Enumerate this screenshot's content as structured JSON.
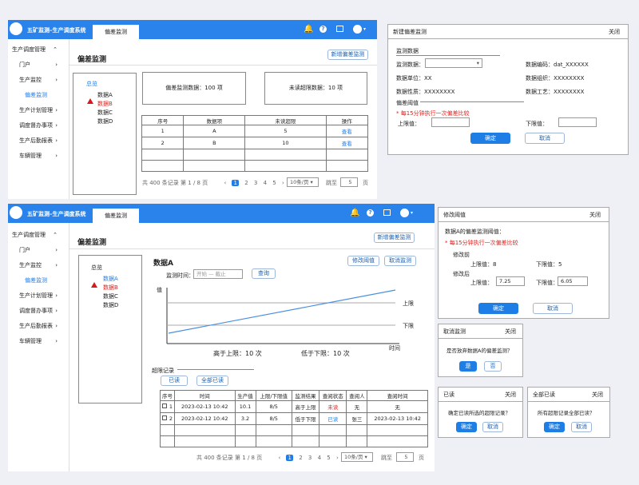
{
  "app": {
    "title": "五矿监测–生产调度系统",
    "tab": "偏差监测"
  },
  "sidebar": [
    {
      "label": "生产调度管理",
      "chev": "⌃"
    },
    {
      "label": "门户",
      "chev": "›"
    },
    {
      "label": "生产监控",
      "chev": "›"
    },
    {
      "label": "偏差监测",
      "chev": ""
    },
    {
      "label": "生产计划管理",
      "chev": "›"
    },
    {
      "label": "调度督办事项",
      "chev": "›"
    },
    {
      "label": "生产后勤报表",
      "chev": "›"
    },
    {
      "label": "车辆管理",
      "chev": "›"
    }
  ],
  "top": {
    "page_title": "偏差监测",
    "new_btn": "新增偏差监测",
    "overview": "总览",
    "items": [
      "数据A",
      "数据B",
      "数据C",
      "数据D"
    ],
    "stat1": "偏差监测数据：100 项",
    "stat2": "未读超限数据：10 项",
    "headers": [
      "序号",
      "数据项",
      "未读超限",
      "操作"
    ],
    "rows": [
      [
        "1",
        "A",
        "5",
        "查看"
      ],
      [
        "2",
        "B",
        "10",
        "查看"
      ]
    ],
    "pager": {
      "total": "共 400 条记录 第 1 / 8 页",
      "pages": [
        "1",
        "2",
        "3",
        "4",
        "5"
      ],
      "size": "10条/页",
      "goto": "跳至",
      "goto_val": "5",
      "page_unit": "页"
    }
  },
  "new_dialog": {
    "title": "新建偏差监测",
    "close": "关闭",
    "sec1": "监测数据",
    "data_label": "监测数据：",
    "code": "数据编码：dat_XXXXXX",
    "unit": "数据单位：XX",
    "org": "数据组织：XXXXXXXX",
    "nature": "数据性质：XXXXXXXX",
    "proc": "数据工艺：XXXXXXXX",
    "sec2": "偏差阈值",
    "note": "* 每15分钟执行一次偏差比较",
    "upper": "上限值：",
    "lower": "下限值：",
    "ok": "确定",
    "cancel": "取消"
  },
  "bottom": {
    "page_title": "偏差监测",
    "new_btn": "新增偏差监测",
    "overview": "总览",
    "items": [
      "数据A",
      "数据B",
      "数据C",
      "数据D"
    ],
    "detail_title": "数据A",
    "edit_btn": "修改阈值",
    "cancel_btn": "取消监测",
    "time_label": "监测时间：",
    "time_placeholder": "开始 — 截止",
    "query": "查询",
    "chart_ylabel": "值",
    "chart_xlabel": "时间",
    "upper_label": "上限",
    "lower_label": "下限",
    "above": "高于上限：10 次",
    "below": "低于下限：10 次",
    "records_title": "超限记录",
    "read_btn": "已读",
    "read_all_btn": "全部已读",
    "headers": [
      "序号",
      "时间",
      "生产值",
      "上限/下限值",
      "监测结果",
      "查阅状态",
      "查阅人",
      "查阅时间"
    ],
    "rows": [
      [
        "1",
        "2023-02-13 10:42",
        "10.1",
        "8/5",
        "高于上限",
        "未读",
        "无",
        "无"
      ],
      [
        "2",
        "2023-02-12 10:42",
        "3.2",
        "8/5",
        "低于下限",
        "已读",
        "张三",
        "2023-02-13 10:42"
      ]
    ],
    "pager": {
      "total": "共 400 条记录 第 1 / 8 页",
      "pages": [
        "1",
        "2",
        "3",
        "4",
        "5"
      ],
      "size": "10条/页",
      "goto": "跳至",
      "goto_val": "5",
      "page_unit": "页"
    }
  },
  "edit_dialog": {
    "title": "修改阈值",
    "close": "关闭",
    "line1": "数据A的偏差监测阈值：",
    "note": "* 每15分钟执行一次偏差比较",
    "before": "修改前",
    "b_upper": "上限值：8",
    "b_lower": "下限值：5",
    "after": "修改后",
    "a_upper": "上限值：",
    "a_upper_val": "7.25",
    "a_lower": "下限值：",
    "a_lower_val": "6.05",
    "ok": "确定",
    "cancel": "取消"
  },
  "cancel_dialog": {
    "title": "取消监测",
    "close": "关闭",
    "text": "是否放弃数据A的偏差监测？",
    "yes": "是",
    "no": "否"
  },
  "read_dialog": {
    "title": "已读",
    "close": "关闭",
    "text": "确定已读所选的超限记录？",
    "ok": "确定",
    "cancel": "取消"
  },
  "readall_dialog": {
    "title": "全部已读",
    "close": "关闭",
    "text": "所有超限记录全部已读？",
    "ok": "确定",
    "cancel": "取消"
  }
}
